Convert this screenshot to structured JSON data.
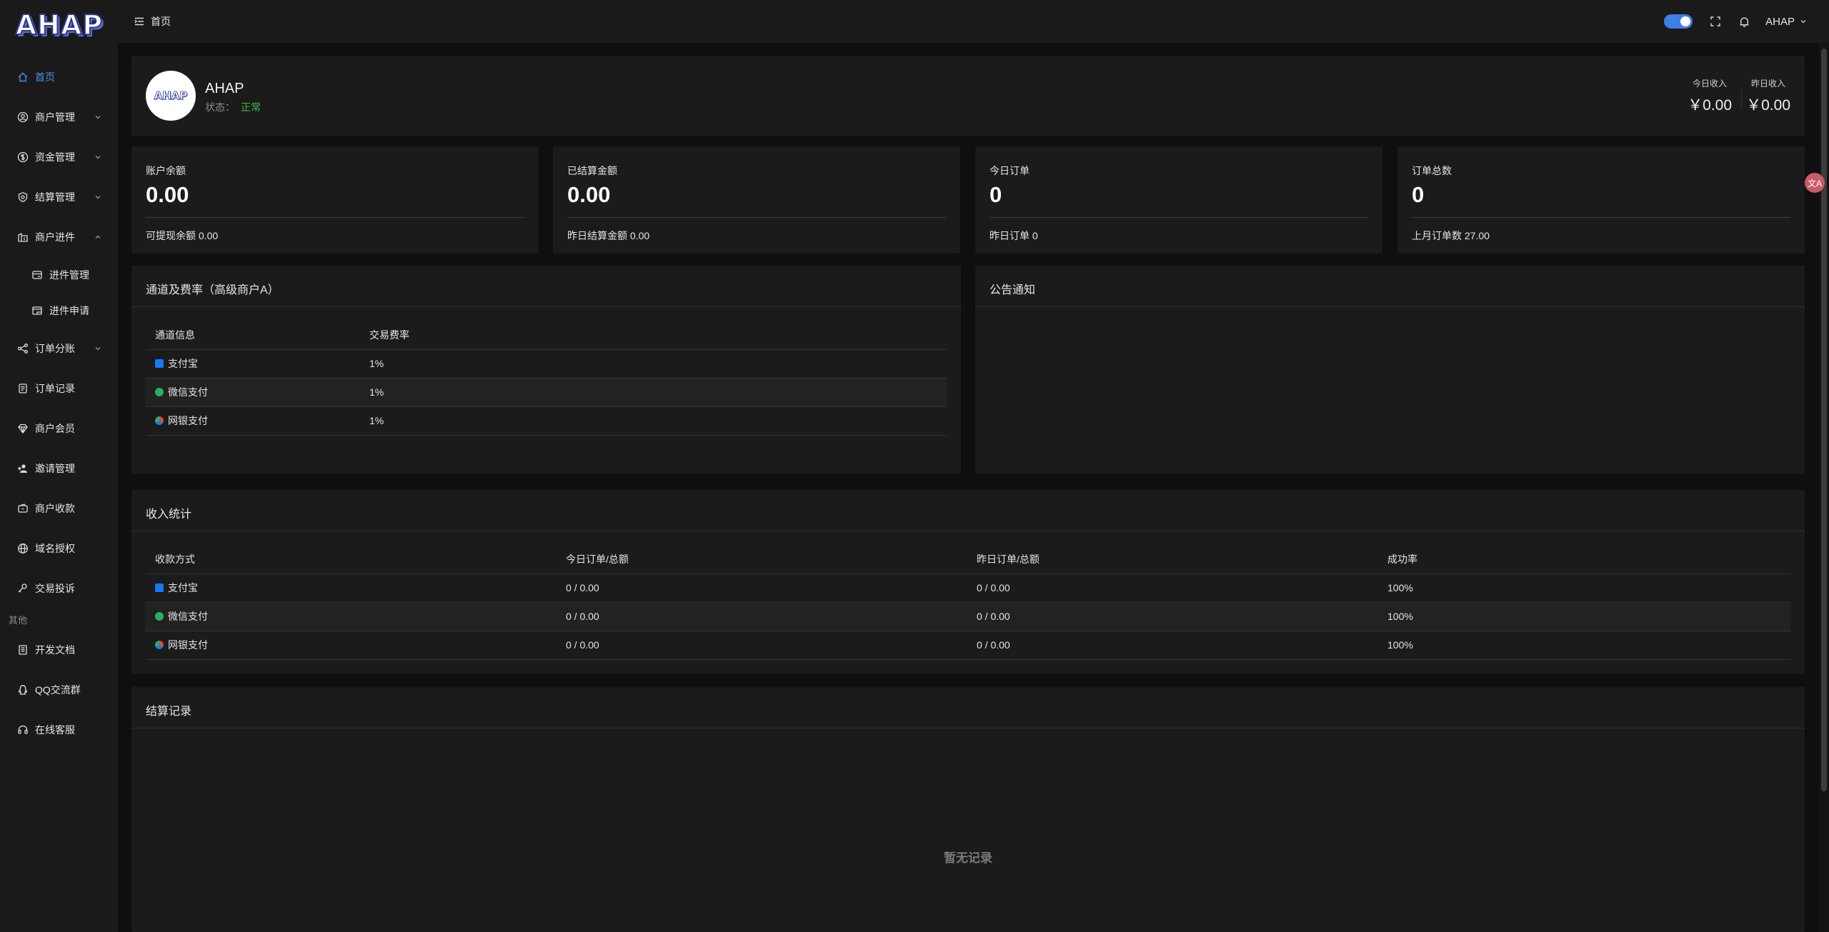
{
  "brand": {
    "logo_text": "AHAP"
  },
  "sidebar": {
    "items": [
      {
        "label": "首页",
        "icon": "home-icon"
      },
      {
        "label": "商户管理",
        "icon": "user-circle-icon"
      },
      {
        "label": "资金管理",
        "icon": "money-icon"
      },
      {
        "label": "结算管理",
        "icon": "shield-icon"
      },
      {
        "label": "商户进件",
        "icon": "building-icon"
      },
      {
        "label": "进件管理",
        "icon": "card-stack-icon"
      },
      {
        "label": "进件申请",
        "icon": "document-icon"
      },
      {
        "label": "订单分账",
        "icon": "share-icon"
      },
      {
        "label": "订单记录",
        "icon": "receipt-icon"
      },
      {
        "label": "商户会员",
        "icon": "diamond-icon"
      },
      {
        "label": "邀请管理",
        "icon": "add-user-icon"
      },
      {
        "label": "商户收款",
        "icon": "wallet-icon"
      },
      {
        "label": "域名授权",
        "icon": "globe-icon"
      },
      {
        "label": "交易投诉",
        "icon": "complaint-icon"
      },
      {
        "label": "开发文档",
        "icon": "doc-icon"
      },
      {
        "label": "QQ交流群",
        "icon": "qq-icon"
      },
      {
        "label": "在线客服",
        "icon": "headset-icon"
      }
    ],
    "group_other": "其他"
  },
  "header": {
    "breadcrumb": "首页",
    "user": "AHAP",
    "accent": "#3e7ee6"
  },
  "profile": {
    "name": "AHAP",
    "status_label": "状态：",
    "status_value": "正常",
    "today_income_label": "今日收入",
    "today_income_value": "￥0.00",
    "yesterday_income_label": "昨日收入",
    "yesterday_income_value": "￥0.00"
  },
  "stats": [
    {
      "label": "账户余额",
      "value": "0.00",
      "sub": "可提现余额 0.00"
    },
    {
      "label": "已结算金额",
      "value": "0.00",
      "sub": "昨日结算金额 0.00"
    },
    {
      "label": "今日订单",
      "value": "0",
      "sub": "昨日订单 0"
    },
    {
      "label": "订单总数",
      "value": "0",
      "sub": "上月订单数 27.00"
    }
  ],
  "channels": {
    "title": "通道及费率（高级商户A）",
    "headers": [
      "通道信息",
      "交易费率"
    ],
    "rows": [
      {
        "name": "支付宝",
        "rate": "1%",
        "color": "#1677ff"
      },
      {
        "name": "微信支付",
        "rate": "1%",
        "color": "#2aae67"
      },
      {
        "name": "网银支付",
        "rate": "1%",
        "color": "#e8453c"
      }
    ]
  },
  "notice": {
    "title": "公告通知"
  },
  "income_stats": {
    "title": "收入统计",
    "headers": [
      "收款方式",
      "今日订单/总额",
      "昨日订单/总额",
      "成功率"
    ],
    "rows": [
      {
        "name": "支付宝",
        "today": "0 / 0.00",
        "yesterday": "0 / 0.00",
        "rate": "100%"
      },
      {
        "name": "微信支付",
        "today": "0 / 0.00",
        "yesterday": "0 / 0.00",
        "rate": "100%"
      },
      {
        "name": "网银支付",
        "today": "0 / 0.00",
        "yesterday": "0 / 0.00",
        "rate": "100%"
      }
    ]
  },
  "settlement": {
    "title": "结算记录",
    "empty": "暂无记录"
  },
  "float_badge": "文A"
}
